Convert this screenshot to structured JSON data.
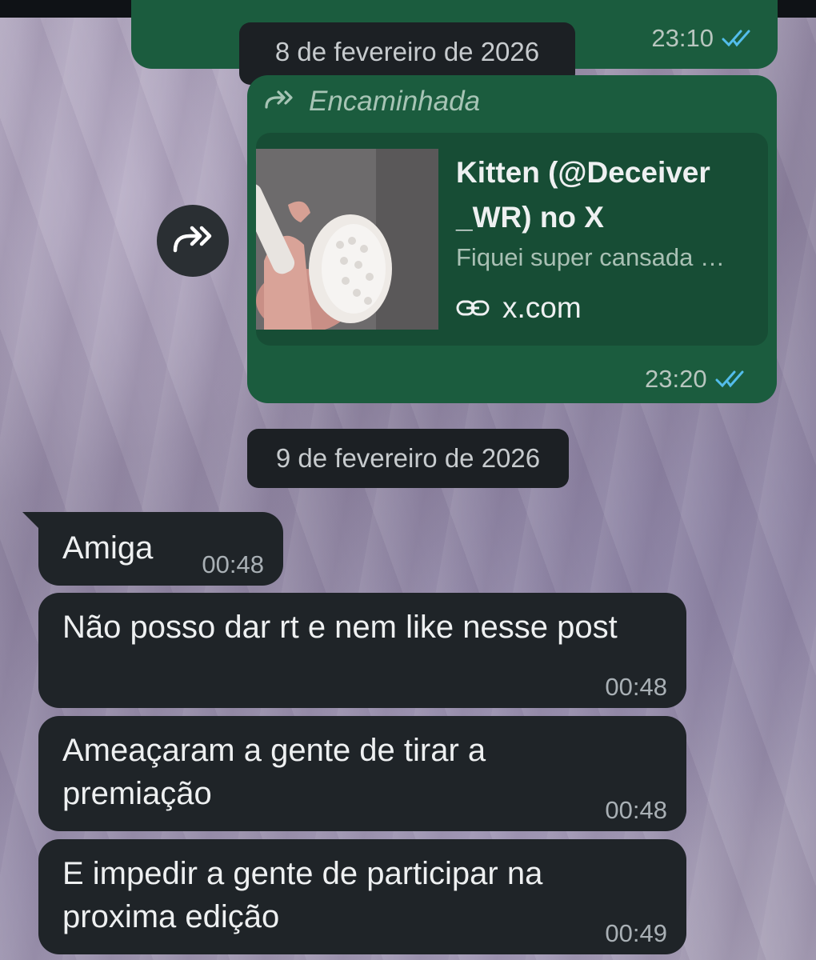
{
  "dates": {
    "first": "8 de fevereiro de 2026",
    "second": "9 de fevereiro de 2026"
  },
  "messages_out": [
    {
      "time": "23:10",
      "status": "read"
    },
    {
      "forwarded_label": "Encaminhada",
      "preview_title": "Kitten (@Deceiver _WR) no X",
      "preview_title_line1": "Kitten (@Deceiver",
      "preview_title_line2": "_WR) no X",
      "preview_description": "Fiquei super cansada …",
      "preview_domain": "x.com",
      "time": "23:20",
      "status": "read"
    }
  ],
  "messages_in": [
    {
      "text": "Amiga",
      "time": "00:48"
    },
    {
      "text": "Não posso dar rt e nem like nesse post",
      "time": "00:48"
    },
    {
      "text": "Ameaçaram a gente de tirar a premiação",
      "time": "00:48"
    },
    {
      "text": "E impedir a gente de participar na proxima edição",
      "time": "00:49"
    }
  ],
  "icons": {
    "tick": "double-check-icon",
    "forward": "forward-icon",
    "link": "link-icon",
    "share": "share-forward-icon"
  },
  "colors": {
    "outgoing_bubble": "#1b5c3e",
    "incoming_bubble": "#1f2428",
    "read_ticks": "#53bdeb"
  }
}
